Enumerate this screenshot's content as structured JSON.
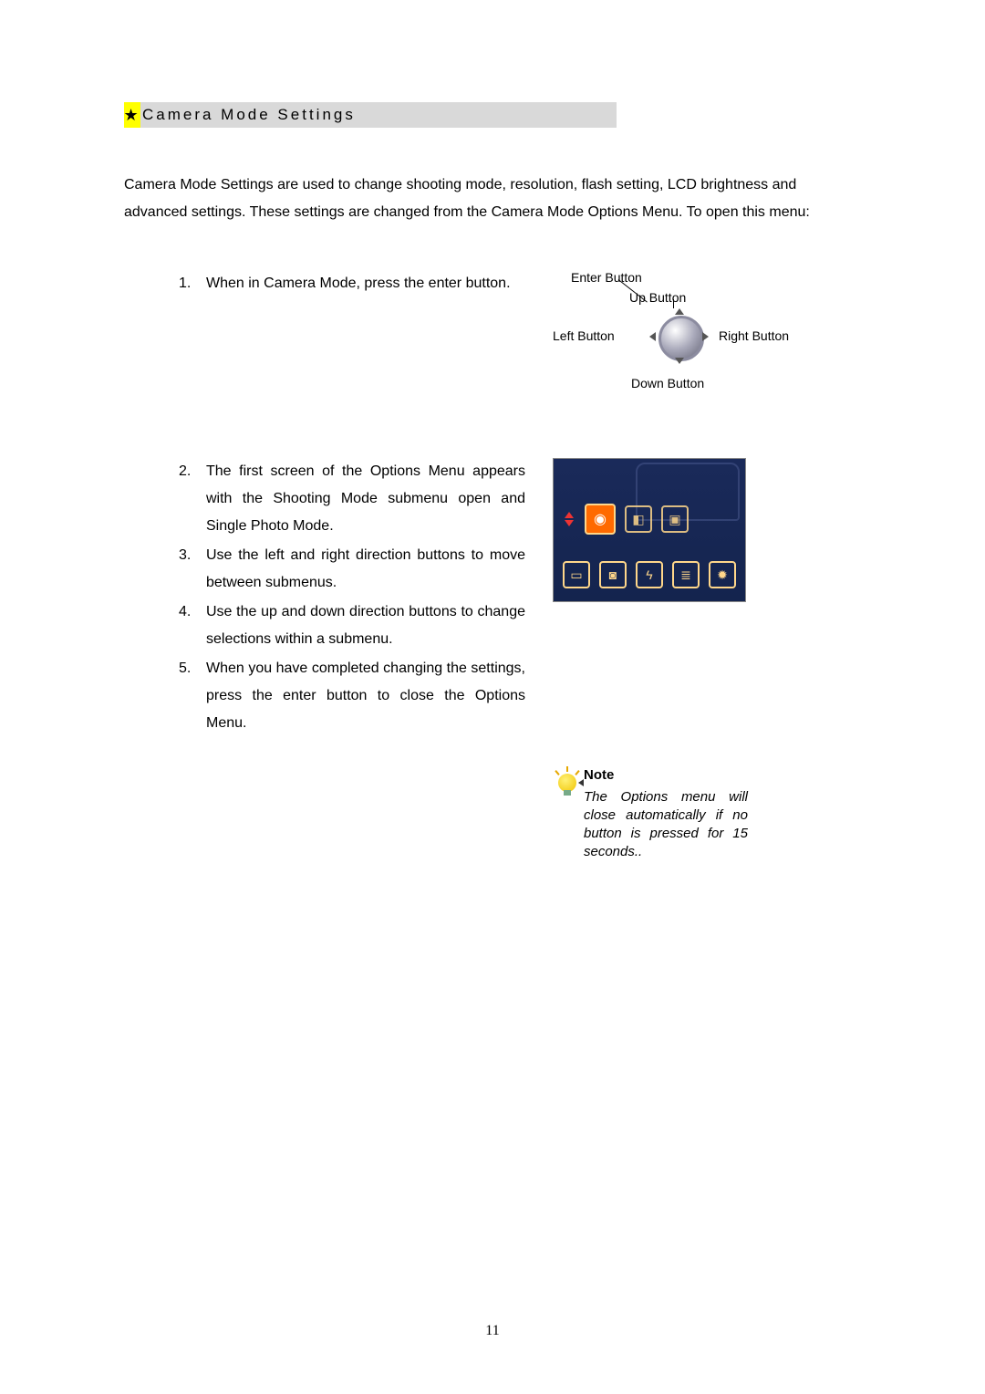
{
  "heading": "Camera Mode Settings",
  "intro": "Camera Mode Settings are used to change shooting mode, resolution, flash setting, LCD brightness and advanced settings. These settings are changed from the Camera Mode Options Menu. To open this menu:",
  "steps1": [
    {
      "n": "1.",
      "t": "When in Camera Mode, press the enter button."
    }
  ],
  "steps2": [
    {
      "n": "2.",
      "t": "The first screen of the Options Menu appears with the Shooting Mode submenu open and Single Photo Mode."
    },
    {
      "n": "3.",
      "t": "Use the left and right direction buttons to move between submenus."
    },
    {
      "n": "4.",
      "t": "Use the up and down direction buttons to change selections within a submenu."
    },
    {
      "n": "5.",
      "t": "When you have completed changing the settings, press the enter button to close the Options Menu."
    }
  ],
  "diagram": {
    "enter": "Enter Button",
    "up": "Up Button",
    "down": "Down Button",
    "left": "Left Button",
    "right": "Right Button"
  },
  "note": {
    "header": "Note",
    "body": "The Options menu will close automatically if no button is pressed for 15 seconds.."
  },
  "page_number": "11"
}
